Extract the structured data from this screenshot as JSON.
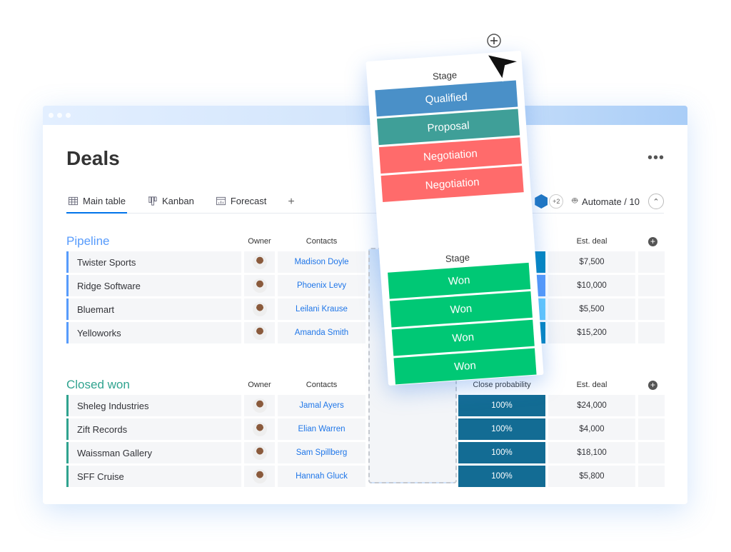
{
  "title": "Deals",
  "tabs": [
    {
      "label": "Main table",
      "icon": "table-icon"
    },
    {
      "label": "Kanban",
      "icon": "kanban-icon"
    },
    {
      "label": "Forecast",
      "icon": "forecast-icon"
    }
  ],
  "add_tab": "+",
  "more": "•••",
  "team_extra": "+2",
  "automate": "Automate / 10",
  "colors": {
    "accent": "#0073ea",
    "pipeline": "#579bfc",
    "closed": "#2fa38f",
    "won": "#00c875",
    "qualified": "#4a90c8",
    "proposal": "#3f9f98",
    "negotiation": "#ff6b6b",
    "prob_won": "#136c94"
  },
  "pipeline": {
    "title": "Pipeline",
    "headers": {
      "owner": "Owner",
      "contacts": "Contacts",
      "est": "Est. deal"
    },
    "rows": [
      {
        "name": "Twister Sports",
        "contact": "Madison Doyle",
        "est": "$7,500",
        "prob_color": "#0086c0"
      },
      {
        "name": "Ridge Software",
        "contact": "Phoenix Levy",
        "est": "$10,000",
        "prob_color": "#579bfc"
      },
      {
        "name": "Bluemart",
        "contact": "Leilani Krause",
        "est": "$5,500",
        "prob_color": "#66ccff"
      },
      {
        "name": "Yelloworks",
        "contact": "Amanda Smith",
        "est": "$15,200",
        "prob_color": "#0086c0"
      }
    ]
  },
  "closed": {
    "title": "Closed won",
    "headers": {
      "owner": "Owner",
      "contacts": "Contacts",
      "prob": "Close probability",
      "est": "Est. deal"
    },
    "rows": [
      {
        "name": "Sheleg Industries",
        "contact": "Jamal Ayers",
        "prob": "100%",
        "est": "$24,000"
      },
      {
        "name": "Zift Records",
        "contact": "Elian Warren",
        "prob": "100%",
        "est": "$4,000"
      },
      {
        "name": "Waissman Gallery",
        "contact": "Sam Spillberg",
        "prob": "100%",
        "est": "$18,100"
      },
      {
        "name": "SFF Cruise",
        "contact": "Hannah Gluck",
        "prob": "100%",
        "est": "$5,800"
      }
    ]
  },
  "card": {
    "stage_label": "Stage",
    "top": [
      "Qualified",
      "Proposal",
      "Negotiation",
      "Negotiation"
    ],
    "bottom": [
      "Won",
      "Won",
      "Won",
      "Won"
    ]
  }
}
